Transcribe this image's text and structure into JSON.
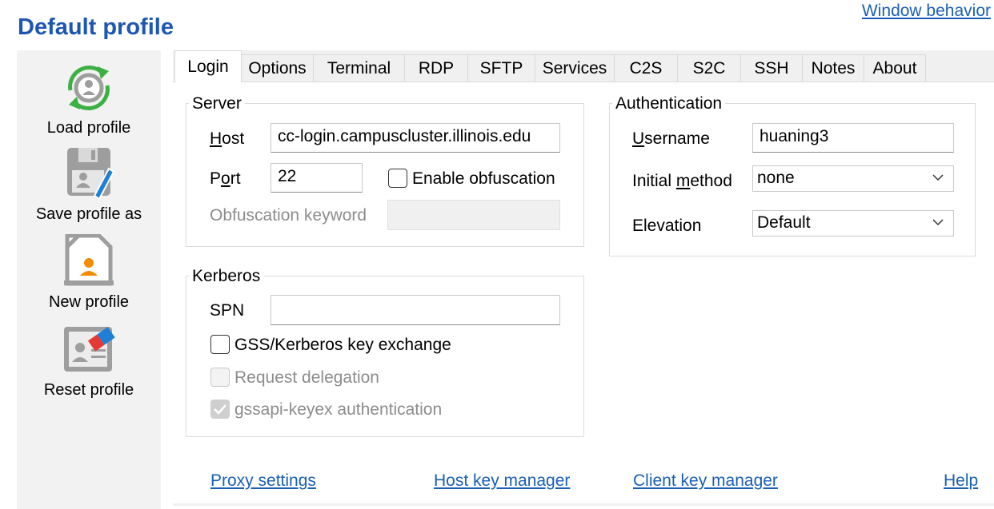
{
  "header": {
    "title": "Default profile",
    "window_behavior_link": "Window behavior"
  },
  "sidebar": {
    "items": [
      {
        "label": "Load profile",
        "icon": "load-profile-icon"
      },
      {
        "label": "Save profile as",
        "icon": "save-profile-icon"
      },
      {
        "label": "New profile",
        "icon": "new-profile-icon"
      },
      {
        "label": "Reset profile",
        "icon": "reset-profile-icon"
      }
    ]
  },
  "tabs": [
    "Login",
    "Options",
    "Terminal",
    "RDP",
    "SFTP",
    "Services",
    "C2S",
    "S2C",
    "SSH",
    "Notes",
    "About"
  ],
  "active_tab": "Login",
  "server": {
    "legend": "Server",
    "host_label": "Host",
    "host_value": "cc-login.campuscluster.illinois.edu",
    "port_label": "Port",
    "port_value": "22",
    "obfuscation_label": "Enable obfuscation",
    "obfuscation_checked": false,
    "keyword_label": "Obfuscation keyword",
    "keyword_value": ""
  },
  "kerberos": {
    "legend": "Kerberos",
    "spn_label": "SPN",
    "spn_value": "",
    "gss_label": "GSS/Kerberos key exchange",
    "gss_checked": false,
    "delegation_label": "Request delegation",
    "delegation_checked": false,
    "gssapi_label": "gssapi-keyex authentication",
    "gssapi_checked": true
  },
  "authentication": {
    "legend": "Authentication",
    "username_label": "Username",
    "username_value": "huaning3",
    "method_label": "Initial method",
    "method_value": "none",
    "elevation_label": "Elevation",
    "elevation_value": "Default"
  },
  "footer_links": {
    "proxy": "Proxy settings",
    "host_key": "Host key manager",
    "client_key": "Client key manager",
    "help": "Help"
  },
  "colors": {
    "title": "#1e56b4",
    "link": "#1a5fb4",
    "icon_green": "#3cb043",
    "icon_orange": "#f28c00",
    "icon_blue": "#1f7fd6",
    "icon_red": "#e53935"
  }
}
